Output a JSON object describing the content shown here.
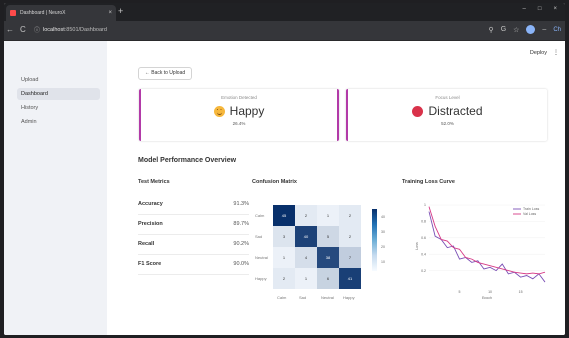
{
  "browser": {
    "tab_title": "Dashboard | NeuroX",
    "tab_close": "×",
    "new_tab": "+",
    "window_controls": [
      "–",
      "□",
      "×"
    ],
    "nav_back": "←",
    "nav_reload": "C",
    "url_host": "localhost",
    "url_rest": ":8501/Dashboard",
    "profile_label": "Ch"
  },
  "header": {
    "deploy_label": "Deploy",
    "menu_glyph": "⋮"
  },
  "sidebar": {
    "items": [
      {
        "label": "Upload"
      },
      {
        "label": "Dashboard"
      },
      {
        "label": "History"
      },
      {
        "label": "Admin"
      }
    ]
  },
  "main": {
    "back_button": "← Back to Upload",
    "emotion_card": {
      "label": "Emotion Detected",
      "value": "Happy",
      "confidence": "26.4%"
    },
    "focus_card": {
      "label": "Focus Level",
      "value": "Distracted",
      "confidence": "52.0%"
    },
    "section_title": "Model Performance Overview",
    "test_metrics": {
      "title": "Test Metrics",
      "rows": [
        {
          "name": "Accuracy",
          "value": "91.3%"
        },
        {
          "name": "Precision",
          "value": "89.7%"
        },
        {
          "name": "Recall",
          "value": "90.2%"
        },
        {
          "name": "F1 Score",
          "value": "90.0%"
        }
      ]
    },
    "confusion_matrix": {
      "title": "Confusion Matrix",
      "labels": [
        "Calm",
        "Sad",
        "Neutral",
        "Happy"
      ],
      "values": [
        [
          45,
          2,
          1,
          2
        ],
        [
          3,
          40,
          5,
          2
        ],
        [
          1,
          4,
          38,
          7
        ],
        [
          2,
          1,
          6,
          41
        ]
      ],
      "colorbar_ticks": [
        "40",
        "30",
        "20",
        "10"
      ]
    },
    "loss_chart_title": "Training Loss Curve"
  },
  "chart_data": {
    "type": "line",
    "title": "Training Loss Curve",
    "xlabel": "Epoch",
    "ylabel": "Loss",
    "xlim": [
      0,
      19
    ],
    "ylim": [
      0,
      1.0
    ],
    "x_ticks": [
      "5",
      "10",
      "15"
    ],
    "y_ticks": [
      "0.2",
      "0.4",
      "0.6",
      "0.8",
      "1"
    ],
    "legend_position": "top-right",
    "series": [
      {
        "name": "Train Loss",
        "color": "#7a4fb5",
        "x": [
          0,
          1,
          2,
          3,
          4,
          5,
          6,
          7,
          8,
          9,
          10,
          11,
          12,
          13,
          14,
          15,
          16,
          17,
          18,
          19
        ],
        "values": [
          0.92,
          0.62,
          0.58,
          0.48,
          0.5,
          0.34,
          0.36,
          0.3,
          0.32,
          0.22,
          0.24,
          0.2,
          0.28,
          0.16,
          0.18,
          0.12,
          0.14,
          0.1,
          0.16,
          0.06
        ]
      },
      {
        "name": "Val Loss",
        "color": "#d63a86",
        "x": [
          0,
          1,
          2,
          3,
          4,
          5,
          6,
          7,
          8,
          9,
          10,
          11,
          12,
          13,
          14,
          15,
          16,
          17,
          18,
          19
        ],
        "values": [
          0.98,
          0.74,
          0.58,
          0.56,
          0.48,
          0.46,
          0.36,
          0.34,
          0.3,
          0.28,
          0.26,
          0.24,
          0.22,
          0.2,
          0.18,
          0.17,
          0.16,
          0.17,
          0.16,
          0.18
        ]
      }
    ]
  }
}
